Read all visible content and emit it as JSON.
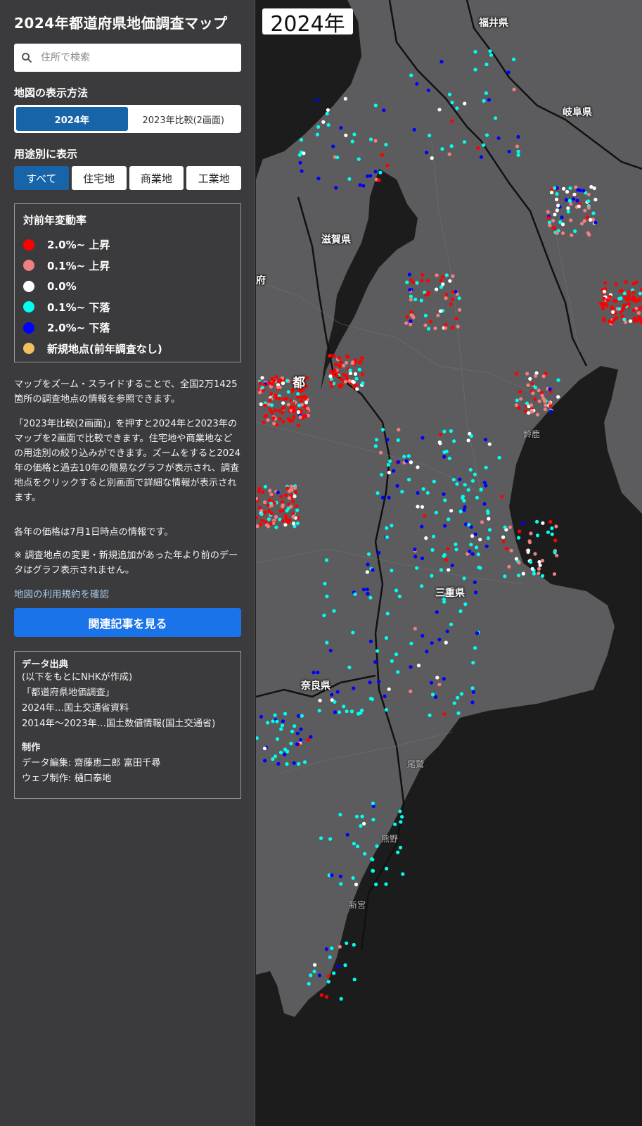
{
  "sidebar": {
    "title": "2024年都道府県地価調査マップ",
    "search": {
      "placeholder": "住所で検索"
    },
    "display_mode": {
      "label": "地図の表示方法",
      "options": [
        "2024年",
        "2023年比較(2画面)"
      ],
      "selected": "2024年"
    },
    "use_filter": {
      "label": "用途別に表示",
      "options": [
        "すべて",
        "住宅地",
        "商業地",
        "工業地"
      ],
      "selected": "すべて"
    },
    "legend": {
      "title": "対前年変動率",
      "items": [
        {
          "label": "2.0%~ 上昇",
          "color": "#ff0000"
        },
        {
          "label": "0.1%~ 上昇",
          "color": "#f08080"
        },
        {
          "label": "0.0%",
          "color": "#ffffff"
        },
        {
          "label": "0.1%~ 下落",
          "color": "#00ffee"
        },
        {
          "label": "2.0%~ 下落",
          "color": "#0000ff"
        },
        {
          "label": "新規地点(前年調査なし)",
          "color": "#f0c060"
        }
      ]
    },
    "description": [
      "マップをズーム・スライドすることで、全国2万1425箇所の調査地点の情報を参照できます。",
      "「2023年比較(2画面)」を押すと2024年と2023年のマップを2画面で比較できます。住宅地や商業地などの用途別の絞り込みができます。ズームをすると2024年の価格と過去10年の簡易なグラフが表示され、調査地点をクリックすると別画面で詳細な情報が表示されます。",
      "各年の価格は7月1日時点の情報です。",
      "※ 調査地点の変更・新規追加があった年より前のデータはグラフ表示されません。"
    ],
    "terms_link": "地図の利用規約を確認",
    "article_button": "関連記事を見る",
    "credits": {
      "source_heading": "データ出典",
      "source_note": "(以下をもとにNHKが作成)",
      "survey_name": "「都道府県地価調査」",
      "source_2024": "2024年…国土交通省資料",
      "source_past": "2014年～2023年…国土数値情報(国土交通省)",
      "production_heading": "制作",
      "data_editing": "データ編集: 齋藤恵二郎 富田千尋",
      "web_production": "ウェブ制作: 樋口泰地"
    }
  },
  "map": {
    "year_badge": "2024年",
    "prefecture_labels": [
      "福井県",
      "岐阜県",
      "滋賀県",
      "三重県",
      "奈良県",
      "府",
      "都"
    ],
    "city_labels": [
      "鈴鹿",
      "尾鷲",
      "熊野",
      "新宮"
    ]
  },
  "colors": {
    "sidebar_bg": "#3b3b3d",
    "accent": "#1765a8",
    "button_blue": "#1a73e8",
    "land": "#5c5c5e",
    "water": "#1c1c1c"
  }
}
